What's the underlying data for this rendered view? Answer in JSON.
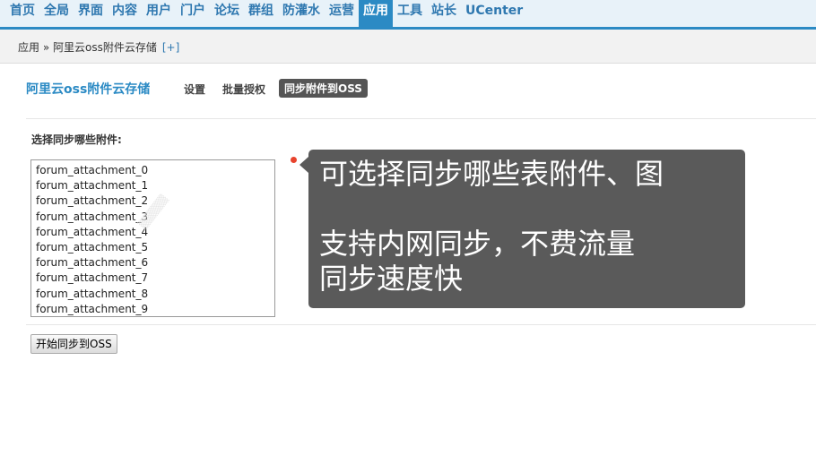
{
  "nav": {
    "items": [
      "首页",
      "全局",
      "界面",
      "内容",
      "用户",
      "门户",
      "论坛",
      "群组",
      "防灌水",
      "运营",
      "应用",
      "工具",
      "站长",
      "UCenter"
    ],
    "active": "应用",
    "colors": {
      "bar": "#e8f2f9",
      "accent": "#2b8ac4",
      "link": "#2f78b0"
    }
  },
  "breadcrumb": {
    "text": "应用 » 阿里云oss附件云存储",
    "plus": "[+]"
  },
  "plugin": {
    "title": "阿里云oss附件云存储",
    "tabs": [
      "设置",
      "批量授权",
      "同步附件到OSS"
    ],
    "active_tab": "同步附件到OSS"
  },
  "form": {
    "label": "选择同步哪些附件:",
    "options": [
      "forum_attachment_0",
      "forum_attachment_1",
      "forum_attachment_2",
      "forum_attachment_3",
      "forum_attachment_4",
      "forum_attachment_5",
      "forum_attachment_6",
      "forum_attachment_7",
      "forum_attachment_8",
      "forum_attachment_9"
    ],
    "submit": "开始同步到OSS"
  },
  "annotation": {
    "text": "可选择同步哪些表附件、图\n\n支持内网同步，不费流量\n同步速度快",
    "colors": {
      "bubble": "#5a5a5a",
      "dot": "#e8432d"
    }
  }
}
